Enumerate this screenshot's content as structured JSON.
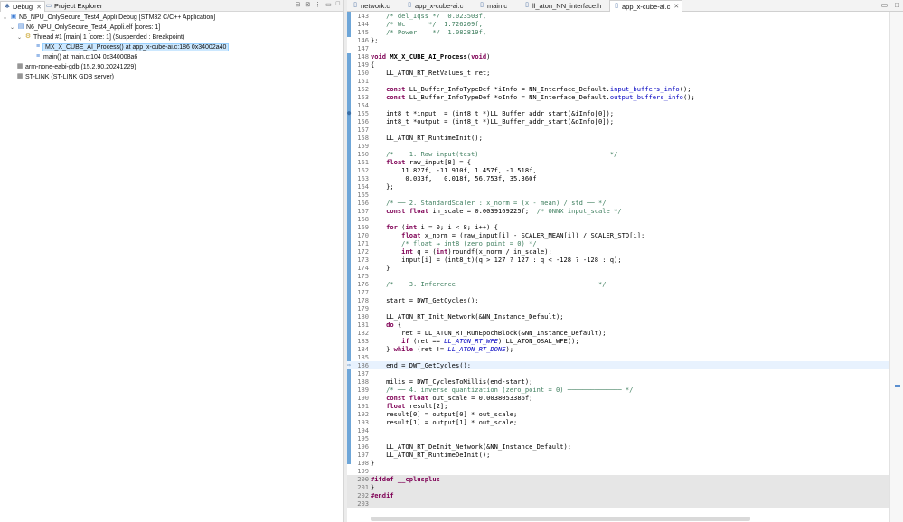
{
  "debug_view": {
    "tab_debug": "Debug",
    "tab_project": "Project Explorer",
    "tree": [
      {
        "label": "N6_NPU_OnlySecure_Test4_Appli Debug [STM32 C/C++ Application]"
      },
      {
        "label": "N6_NPU_OnlySecure_Test4_Appli.elf [cores: 1]"
      },
      {
        "label": "Thread #1 [main] 1 [core: 1] (Suspended : Breakpoint)"
      },
      {
        "label": "MX_X_CUBE_AI_Process() at app_x-cube-ai.c:186 0x34002a40"
      },
      {
        "label": "main() at main.c:104 0x340008a6"
      },
      {
        "label": "arm-none-eabi-gdb (15.2.90.20241229)"
      },
      {
        "label": "ST-LINK (ST-LINK GDB server)"
      }
    ]
  },
  "editor": {
    "tabs": [
      "network.c",
      "app_x-cube-ai.c",
      "main.c",
      "ll_aton_NN_interface.h",
      "app_x-cube-ai.c"
    ],
    "lines": [
      {
        "n": "143",
        "t": "    /* del_Iqss */  0.023503f,",
        "k": "com"
      },
      {
        "n": "144",
        "t": "    /* Wc      */  1.726209f,",
        "k": "com"
      },
      {
        "n": "145",
        "t": "    /* Power    */  1.082819f,",
        "k": "com"
      },
      {
        "n": "146",
        "t": "};",
        "k": ""
      },
      {
        "n": "147",
        "t": "",
        "k": ""
      },
      {
        "n": "148",
        "t": "void MX_X_CUBE_AI_Process(void)",
        "k": "func"
      },
      {
        "n": "149",
        "t": "{",
        "k": ""
      },
      {
        "n": "150",
        "t": "    LL_ATON_RT_RetValues_t ret;",
        "k": ""
      },
      {
        "n": "151",
        "t": "",
        "k": ""
      },
      {
        "n": "152",
        "t": "    const LL_Buffer_InfoTypeDef *iInfo = NN_Interface_Default.input_buffers_info();",
        "k": "const"
      },
      {
        "n": "153",
        "t": "    const LL_Buffer_InfoTypeDef *oInfo = NN_Interface_Default.output_buffers_info();",
        "k": "const"
      },
      {
        "n": "154",
        "t": "",
        "k": ""
      },
      {
        "n": "155",
        "t": "    int8_t *input  = (int8_t *)LL_Buffer_addr_start(&iInfo[0]);",
        "k": ""
      },
      {
        "n": "156",
        "t": "    int8_t *output = (int8_t *)LL_Buffer_addr_start(&oInfo[0]);",
        "k": ""
      },
      {
        "n": "157",
        "t": "",
        "k": ""
      },
      {
        "n": "158",
        "t": "    LL_ATON_RT_RuntimeInit();",
        "k": ""
      },
      {
        "n": "159",
        "t": "",
        "k": ""
      },
      {
        "n": "160",
        "t": "    /* ── 1. Raw input(test) ──────────────────────────────── */",
        "k": "com"
      },
      {
        "n": "161",
        "t": "    float raw_input[8] = {",
        "k": "float"
      },
      {
        "n": "162",
        "t": "        11.827f, -11.910f, 1.457f, -1.518f,",
        "k": ""
      },
      {
        "n": "163",
        "t": "         0.033f,   0.018f, 56.753f, 35.360f",
        "k": ""
      },
      {
        "n": "164",
        "t": "    };",
        "k": ""
      },
      {
        "n": "165",
        "t": "",
        "k": ""
      },
      {
        "n": "166",
        "t": "    /* ── 2. StandardScaler : x_norm = (x - mean) / std ── */",
        "k": "com"
      },
      {
        "n": "167",
        "t": "    const float in_scale = 0.0039169225f;  /* ONNX input_scale */",
        "k": "constcom"
      },
      {
        "n": "168",
        "t": "",
        "k": ""
      },
      {
        "n": "169",
        "t": "    for (int i = 0; i < 8; i++) {",
        "k": "for"
      },
      {
        "n": "170",
        "t": "        float x_norm = (raw_input[i] - SCALER_MEAN[i]) / SCALER_STD[i];",
        "k": "float"
      },
      {
        "n": "171",
        "t": "        /* float → int8 (zero_point = 0) */",
        "k": "com"
      },
      {
        "n": "172",
        "t": "        int q = (int)roundf(x_norm / in_scale);",
        "k": "int"
      },
      {
        "n": "173",
        "t": "        input[i] = (int8_t)(q > 127 ? 127 : q < -128 ? -128 : q);",
        "k": ""
      },
      {
        "n": "174",
        "t": "    }",
        "k": ""
      },
      {
        "n": "175",
        "t": "",
        "k": ""
      },
      {
        "n": "176",
        "t": "    /* ── 3. Inference ─────────────────────────────────── */",
        "k": "com"
      },
      {
        "n": "177",
        "t": "",
        "k": ""
      },
      {
        "n": "178",
        "t": "    start = DWT_GetCycles();",
        "k": ""
      },
      {
        "n": "179",
        "t": "",
        "k": ""
      },
      {
        "n": "180",
        "t": "    LL_ATON_RT_Init_Network(&NN_Instance_Default);",
        "k": ""
      },
      {
        "n": "181",
        "t": "    do {",
        "k": "do"
      },
      {
        "n": "182",
        "t": "        ret = LL_ATON_RT_RunEpochBlock(&NN_Instance_Default);",
        "k": ""
      },
      {
        "n": "183",
        "t": "        if (ret == LL_ATON_RT_WFE) LL_ATON_OSAL_WFE();",
        "k": "if"
      },
      {
        "n": "184",
        "t": "    } while (ret != LL_ATON_RT_DONE);",
        "k": "while"
      },
      {
        "n": "185",
        "t": "",
        "k": ""
      },
      {
        "n": "186",
        "t": "    end = DWT_GetCycles();",
        "k": "current"
      },
      {
        "n": "187",
        "t": "",
        "k": ""
      },
      {
        "n": "188",
        "t": "    milis = DWT_CyclesToMillis(end-start);",
        "k": ""
      },
      {
        "n": "189",
        "t": "    /* ── 4. inverse quantization (zero_point = 0) ────────────── */",
        "k": "com"
      },
      {
        "n": "190",
        "t": "    const float out_scale = 0.0038053386f;",
        "k": "const"
      },
      {
        "n": "191",
        "t": "    float result[2];",
        "k": "float"
      },
      {
        "n": "192",
        "t": "    result[0] = output[0] * out_scale;",
        "k": ""
      },
      {
        "n": "193",
        "t": "    result[1] = output[1] * out_scale;",
        "k": ""
      },
      {
        "n": "194",
        "t": "",
        "k": ""
      },
      {
        "n": "195",
        "t": "",
        "k": ""
      },
      {
        "n": "196",
        "t": "    LL_ATON_RT_DeInit_Network(&NN_Instance_Default);",
        "k": ""
      },
      {
        "n": "197",
        "t": "    LL_ATON_RT_RuntimeDeInit();",
        "k": ""
      },
      {
        "n": "198",
        "t": "}",
        "k": ""
      },
      {
        "n": "199",
        "t": "",
        "k": ""
      },
      {
        "n": "200",
        "t": "#ifdef __cplusplus",
        "k": "dir"
      },
      {
        "n": "201",
        "t": "}",
        "k": "grey"
      },
      {
        "n": "202",
        "t": "#endif",
        "k": "dir"
      },
      {
        "n": "203",
        "t": "",
        "k": ""
      }
    ]
  }
}
